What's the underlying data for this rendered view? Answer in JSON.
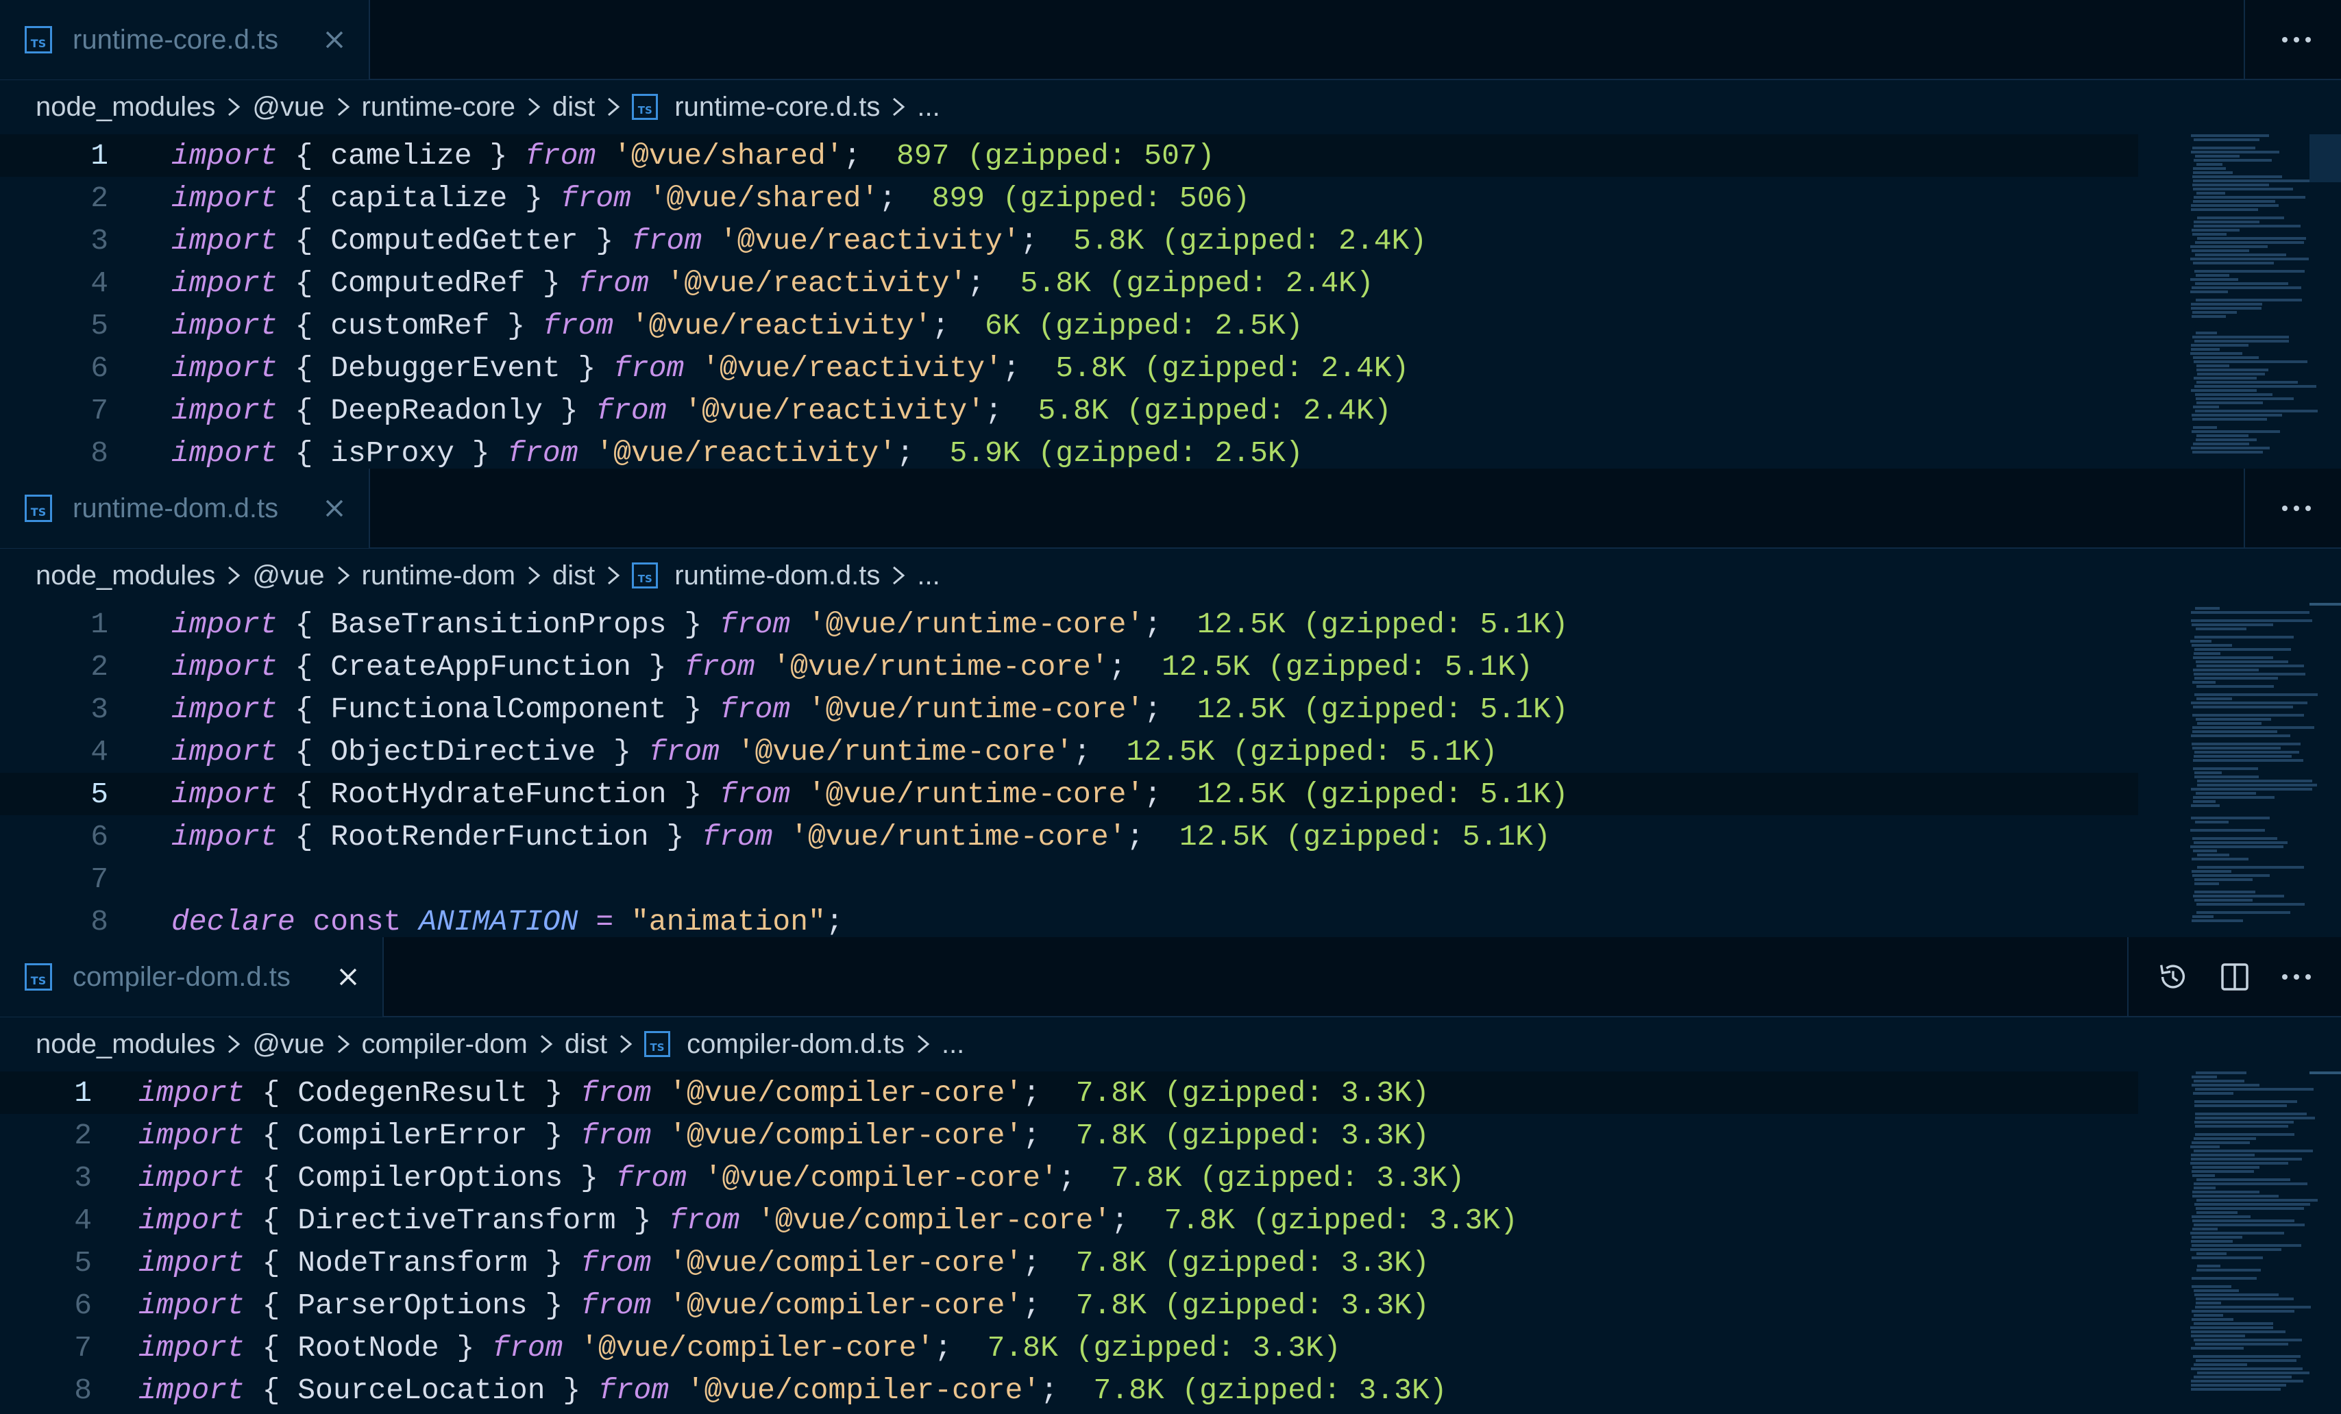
{
  "colors": {
    "background": "#011627",
    "tab_text": "#5f7e97",
    "keyword": "#c792ea",
    "string": "#ecc48d",
    "size_annotation": "#addb67",
    "line_number": "#4b6479"
  },
  "panes": [
    {
      "tab": {
        "icon": "typescript-file-icon",
        "icon_text": "TS",
        "label": "runtime-core.d.ts",
        "close_icon": "close-icon"
      },
      "actions": [
        "more-actions-icon"
      ],
      "breadcrumb": [
        "node_modules",
        "@vue",
        "runtime-core",
        "dist",
        "runtime-core.d.ts",
        "..."
      ],
      "active_line": 1,
      "lines": [
        {
          "num": "1",
          "kw": "import",
          "open": "{ ",
          "name": "camelize",
          "close": " }",
          "from": "from",
          "module": "'@vue/shared'",
          "semi": ";",
          "size": "897 (gzipped: 507)"
        },
        {
          "num": "2",
          "kw": "import",
          "open": "{ ",
          "name": "capitalize",
          "close": " }",
          "from": "from",
          "module": "'@vue/shared'",
          "semi": ";",
          "size": "899 (gzipped: 506)"
        },
        {
          "num": "3",
          "kw": "import",
          "open": "{ ",
          "name": "ComputedGetter",
          "close": " }",
          "from": "from",
          "module": "'@vue/reactivity'",
          "semi": ";",
          "size": "5.8K (gzipped: 2.4K)"
        },
        {
          "num": "4",
          "kw": "import",
          "open": "{ ",
          "name": "ComputedRef",
          "close": " }",
          "from": "from",
          "module": "'@vue/reactivity'",
          "semi": ";",
          "size": "5.8K (gzipped: 2.4K)"
        },
        {
          "num": "5",
          "kw": "import",
          "open": "{ ",
          "name": "customRef",
          "close": " }",
          "from": "from",
          "module": "'@vue/reactivity'",
          "semi": ";",
          "size": "6K (gzipped: 2.5K)"
        },
        {
          "num": "6",
          "kw": "import",
          "open": "{ ",
          "name": "DebuggerEvent",
          "close": " }",
          "from": "from",
          "module": "'@vue/reactivity'",
          "semi": ";",
          "size": "5.8K (gzipped: 2.4K)"
        },
        {
          "num": "7",
          "kw": "import",
          "open": "{ ",
          "name": "DeepReadonly",
          "close": " }",
          "from": "from",
          "module": "'@vue/reactivity'",
          "semi": ";",
          "size": "5.8K (gzipped: 2.4K)"
        },
        {
          "num": "8",
          "kw": "import",
          "open": "{ ",
          "name": "isProxy",
          "close": " }",
          "from": "from",
          "module": "'@vue/reactivity'",
          "semi": ";",
          "size": "5.9K (gzipped: 2.5K)"
        }
      ]
    },
    {
      "tab": {
        "icon": "typescript-file-icon",
        "icon_text": "TS",
        "label": "runtime-dom.d.ts",
        "close_icon": "close-icon"
      },
      "actions": [
        "more-actions-icon"
      ],
      "breadcrumb": [
        "node_modules",
        "@vue",
        "runtime-dom",
        "dist",
        "runtime-dom.d.ts",
        "..."
      ],
      "active_line": 5,
      "lines": [
        {
          "num": "1",
          "kw": "import",
          "open": "{ ",
          "name": "BaseTransitionProps",
          "close": " }",
          "from": "from",
          "module": "'@vue/runtime-core'",
          "semi": ";",
          "size": "12.5K (gzipped: 5.1K)"
        },
        {
          "num": "2",
          "kw": "import",
          "open": "{ ",
          "name": "CreateAppFunction",
          "close": " }",
          "from": "from",
          "module": "'@vue/runtime-core'",
          "semi": ";",
          "size": "12.5K (gzipped: 5.1K)"
        },
        {
          "num": "3",
          "kw": "import",
          "open": "{ ",
          "name": "FunctionalComponent",
          "close": " }",
          "from": "from",
          "module": "'@vue/runtime-core'",
          "semi": ";",
          "size": "12.5K (gzipped: 5.1K)"
        },
        {
          "num": "4",
          "kw": "import",
          "open": "{ ",
          "name": "ObjectDirective",
          "close": " }",
          "from": "from",
          "module": "'@vue/runtime-core'",
          "semi": ";",
          "size": "12.5K (gzipped: 5.1K)"
        },
        {
          "num": "5",
          "kw": "import",
          "open": "{ ",
          "name": "RootHydrateFunction",
          "close": " }",
          "from": "from",
          "module": "'@vue/runtime-core'",
          "semi": ";",
          "size": "12.5K (gzipped: 5.1K)"
        },
        {
          "num": "6",
          "kw": "import",
          "open": "{ ",
          "name": "RootRenderFunction",
          "close": " }",
          "from": "from",
          "module": "'@vue/runtime-core'",
          "semi": ";",
          "size": "12.5K (gzipped: 5.1K)"
        },
        {
          "num": "7",
          "blank": true
        },
        {
          "num": "8",
          "decl": true,
          "kw1": "declare",
          "kw2": "const",
          "var": "ANIMATION",
          "eq": "=",
          "value": "\"animation\"",
          "semi": ";"
        }
      ]
    },
    {
      "tab": {
        "icon": "typescript-file-icon",
        "icon_text": "TS",
        "label": "compiler-dom.d.ts",
        "close_icon": "close-icon"
      },
      "actions": [
        "timeline-icon",
        "split-editor-icon",
        "more-actions-icon"
      ],
      "breadcrumb": [
        "node_modules",
        "@vue",
        "compiler-dom",
        "dist",
        "compiler-dom.d.ts",
        "..."
      ],
      "active_line": 1,
      "lines": [
        {
          "num": "1",
          "kw": "import",
          "open": "{ ",
          "name": "CodegenResult",
          "close": " }",
          "from": "from",
          "module": "'@vue/compiler-core'",
          "semi": ";",
          "size": "7.8K (gzipped: 3.3K)"
        },
        {
          "num": "2",
          "kw": "import",
          "open": "{ ",
          "name": "CompilerError",
          "close": " }",
          "from": "from",
          "module": "'@vue/compiler-core'",
          "semi": ";",
          "size": "7.8K (gzipped: 3.3K)"
        },
        {
          "num": "3",
          "kw": "import",
          "open": "{ ",
          "name": "CompilerOptions",
          "close": " }",
          "from": "from",
          "module": "'@vue/compiler-core'",
          "semi": ";",
          "size": "7.8K (gzipped: 3.3K)"
        },
        {
          "num": "4",
          "kw": "import",
          "open": "{ ",
          "name": "DirectiveTransform",
          "close": " }",
          "from": "from",
          "module": "'@vue/compiler-core'",
          "semi": ";",
          "size": "7.8K (gzipped: 3.3K)"
        },
        {
          "num": "5",
          "kw": "import",
          "open": "{ ",
          "name": "NodeTransform",
          "close": " }",
          "from": "from",
          "module": "'@vue/compiler-core'",
          "semi": ";",
          "size": "7.8K (gzipped: 3.3K)"
        },
        {
          "num": "6",
          "kw": "import",
          "open": "{ ",
          "name": "ParserOptions",
          "close": " }",
          "from": "from",
          "module": "'@vue/compiler-core'",
          "semi": ";",
          "size": "7.8K (gzipped: 3.3K)"
        },
        {
          "num": "7",
          "kw": "import",
          "open": "{ ",
          "name": "RootNode",
          "close": " }",
          "from": "from",
          "module": "'@vue/compiler-core'",
          "semi": ";",
          "size": "7.8K (gzipped: 3.3K)"
        },
        {
          "num": "8",
          "kw": "import",
          "open": "{ ",
          "name": "SourceLocation",
          "close": " }",
          "from": "from",
          "module": "'@vue/compiler-core'",
          "semi": ";",
          "size": "7.8K (gzipped: 3.3K)"
        }
      ]
    }
  ]
}
